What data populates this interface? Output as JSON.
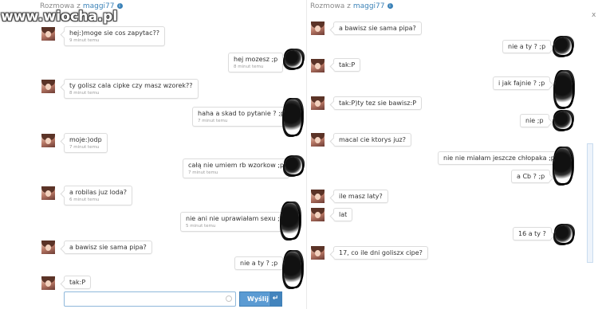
{
  "watermark": "www.wiocha.pl",
  "left": {
    "header": {
      "label": "Rozmowa z",
      "user": "maggi77",
      "info_icon": "info-icon"
    },
    "messages": [
      {
        "side": "in",
        "text": "hej:)moge sie cos zapytac??",
        "time": "9 minut temu"
      },
      {
        "side": "out",
        "text": "hej mozesz ;p",
        "time": "8 minut temu"
      },
      {
        "side": "in",
        "text": "ty golisz cala cipke czy masz wzorek??",
        "time": "8 minut temu"
      },
      {
        "side": "out",
        "text": "haha a skad to pytanie ? ;p",
        "time": "7 minut temu"
      },
      {
        "side": "in",
        "text": "moje:)odp",
        "time": "7 minut temu"
      },
      {
        "side": "out",
        "text": "całą nie umiem rb wzorkow ;p",
        "time": "7 minut temu"
      },
      {
        "side": "in",
        "text": "a robilas juz loda?",
        "time": "6 minut temu"
      },
      {
        "side": "out",
        "text": "nie ani nie uprawiałam sexu ;p",
        "time": "5 minut temu"
      },
      {
        "side": "in",
        "text": "a bawisz sie sama pipa?",
        "time": ""
      },
      {
        "side": "out",
        "text": "nie a ty ? ;p",
        "time": ""
      },
      {
        "side": "in",
        "text": "tak:P",
        "time": ""
      }
    ],
    "composer": {
      "placeholder": "",
      "send_label": "Wyślij",
      "enter_icon": "↵"
    }
  },
  "right": {
    "header": {
      "label": "Rozmowa z",
      "user": "maggi77",
      "info_icon": "info-icon"
    },
    "messages": [
      {
        "side": "in",
        "text": "a bawisz sie sama pipa?"
      },
      {
        "side": "out",
        "text": "nie a ty ? ;p"
      },
      {
        "side": "in",
        "text": "tak:P"
      },
      {
        "side": "out",
        "text": "i jak fajnie ? ;p"
      },
      {
        "side": "in",
        "text": "tak:P)ty tez sie bawisz:P"
      },
      {
        "side": "out",
        "text": "nie ;p"
      },
      {
        "side": "in",
        "text": "macal cie ktorys juz?"
      },
      {
        "side": "out",
        "text": "nie nie miałam jeszcze chłopaka ;p"
      },
      {
        "side": "out",
        "text": "a Cb ? ;p"
      },
      {
        "side": "in",
        "text": "ile masz laty?"
      },
      {
        "side": "in",
        "text": "lat"
      },
      {
        "side": "out",
        "text": "16 a ty ?"
      },
      {
        "side": "in",
        "text": "17, co ile dni goliszx cipe?"
      }
    ],
    "close_label": "x"
  }
}
